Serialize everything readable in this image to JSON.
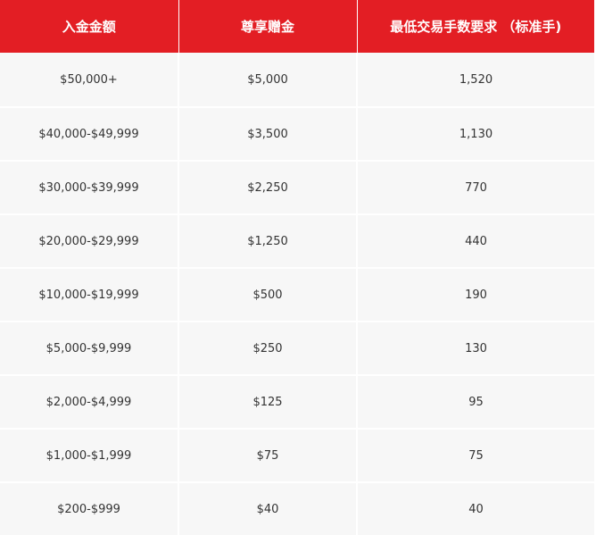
{
  "table": {
    "headers": [
      "入金金额",
      "尊享赠金",
      "最低交易手数要求 （标准手)"
    ],
    "rows": [
      [
        "$50,000+",
        "$5,000",
        "1,520"
      ],
      [
        "$40,000-$49,999",
        "$3,500",
        "1,130"
      ],
      [
        "$30,000-$39,999",
        "$2,250",
        "770"
      ],
      [
        "$20,000-$29,999",
        "$1,250",
        "440"
      ],
      [
        "$10,000-$19,999",
        "$500",
        "190"
      ],
      [
        "$5,000-$9,999",
        "$250",
        "130"
      ],
      [
        "$2,000-$4,999",
        "$125",
        "95"
      ],
      [
        "$1,000-$1,999",
        "$75",
        "75"
      ],
      [
        "$200-$999",
        "$40",
        "40"
      ]
    ]
  },
  "colors": {
    "header_bg": "#e31e24",
    "header_text": "#ffffff",
    "row_bg": "#f7f7f7",
    "cell_text": "#333333"
  }
}
